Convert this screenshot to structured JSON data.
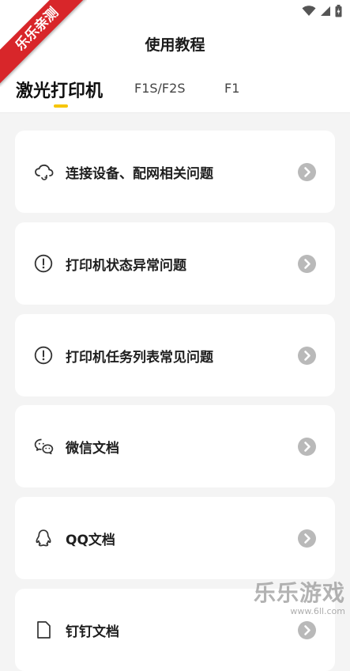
{
  "header": {
    "title": "使用教程"
  },
  "tabs": [
    {
      "label": "激光打印机"
    },
    {
      "label": "F1S/F2S"
    },
    {
      "label": "F1"
    }
  ],
  "cards": [
    {
      "icon": "cloud-sync-icon",
      "label": "连接设备、配网相关问题"
    },
    {
      "icon": "alert-circle-icon",
      "label": "打印机状态异常问题"
    },
    {
      "icon": "alert-circle-icon",
      "label": "打印机任务列表常见问题"
    },
    {
      "icon": "wechat-icon",
      "label": "微信文档"
    },
    {
      "icon": "qq-icon",
      "label": "QQ文档"
    },
    {
      "icon": "document-icon",
      "label": "钉钉文档"
    }
  ],
  "overlays": {
    "ribbon": "乐乐亲测",
    "watermark": "乐乐游戏",
    "watermark_url": "www.6ll.com"
  },
  "colors": {
    "accent": "#f6c500",
    "ribbon": "#d8262a",
    "chevron": "#b9b9b9"
  }
}
